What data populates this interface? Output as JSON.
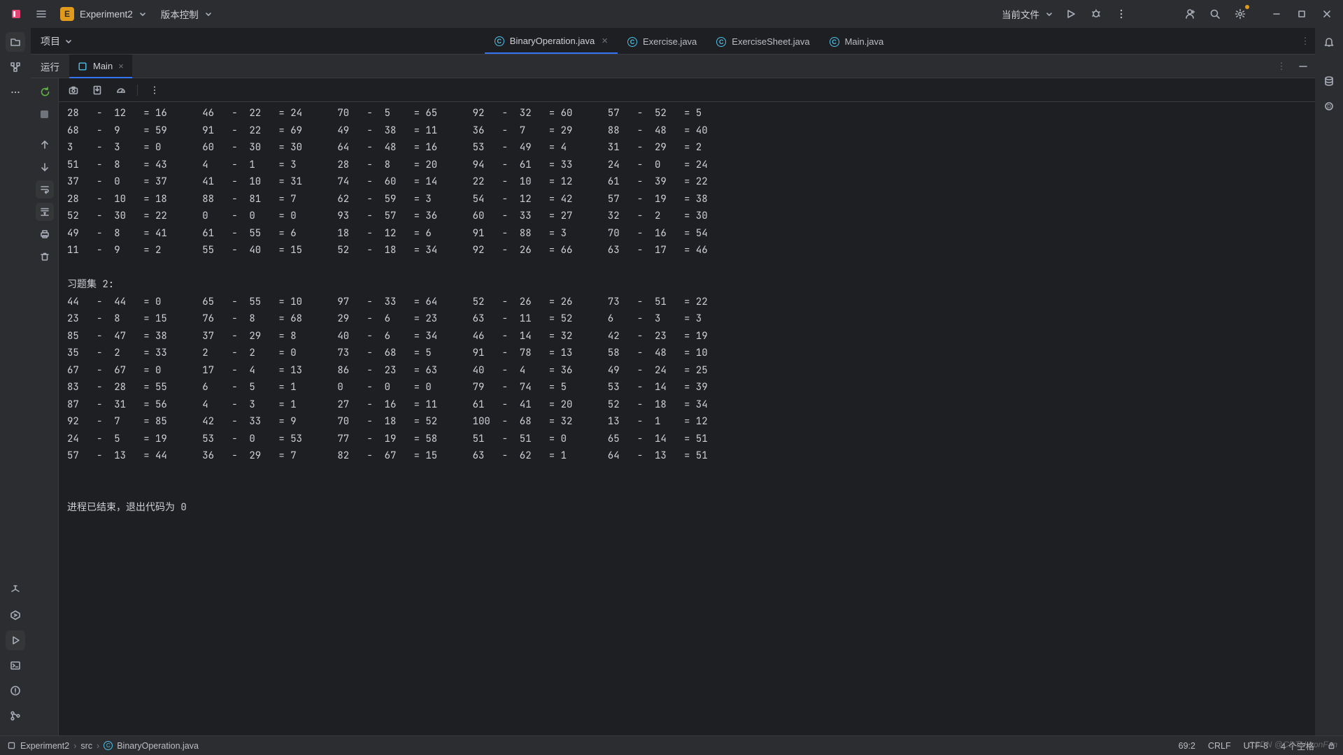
{
  "title_bar": {
    "project_letter": "E",
    "project_name": "Experiment2",
    "vcs_label": "版本控制",
    "current_file_label": "当前文件"
  },
  "editor_tabs": [
    {
      "name": "BinaryOperation.java",
      "active": true,
      "closable": true
    },
    {
      "name": "Exercise.java",
      "active": false,
      "closable": false
    },
    {
      "name": "ExerciseSheet.java",
      "active": false,
      "closable": false
    },
    {
      "name": "Main.java",
      "active": false,
      "closable": false
    }
  ],
  "project_dropdown": "项目",
  "run": {
    "tool_label": "运行",
    "tab_name": "Main",
    "exit_line": "进程已结束，退出代码为 0",
    "set2_header": "习题集 2:",
    "output_block1": [
      [
        [
          "28",
          "12",
          "16"
        ],
        [
          "46",
          "22",
          "24"
        ],
        [
          "70",
          "5",
          "65"
        ],
        [
          "92",
          "32",
          "60"
        ],
        [
          "57",
          "52",
          "5"
        ]
      ],
      [
        [
          "68",
          "9",
          "59"
        ],
        [
          "91",
          "22",
          "69"
        ],
        [
          "49",
          "38",
          "11"
        ],
        [
          "36",
          "7",
          "29"
        ],
        [
          "88",
          "48",
          "40"
        ]
      ],
      [
        [
          "3",
          "3",
          "0"
        ],
        [
          "60",
          "30",
          "30"
        ],
        [
          "64",
          "48",
          "16"
        ],
        [
          "53",
          "49",
          "4"
        ],
        [
          "31",
          "29",
          "2"
        ]
      ],
      [
        [
          "51",
          "8",
          "43"
        ],
        [
          "4",
          "1",
          "3"
        ],
        [
          "28",
          "8",
          "20"
        ],
        [
          "94",
          "61",
          "33"
        ],
        [
          "24",
          "0",
          "24"
        ]
      ],
      [
        [
          "37",
          "0",
          "37"
        ],
        [
          "41",
          "10",
          "31"
        ],
        [
          "74",
          "60",
          "14"
        ],
        [
          "22",
          "10",
          "12"
        ],
        [
          "61",
          "39",
          "22"
        ]
      ],
      [
        [
          "28",
          "10",
          "18"
        ],
        [
          "88",
          "81",
          "7"
        ],
        [
          "62",
          "59",
          "3"
        ],
        [
          "54",
          "12",
          "42"
        ],
        [
          "57",
          "19",
          "38"
        ]
      ],
      [
        [
          "52",
          "30",
          "22"
        ],
        [
          "0",
          "0",
          "0"
        ],
        [
          "93",
          "57",
          "36"
        ],
        [
          "60",
          "33",
          "27"
        ],
        [
          "32",
          "2",
          "30"
        ]
      ],
      [
        [
          "49",
          "8",
          "41"
        ],
        [
          "61",
          "55",
          "6"
        ],
        [
          "18",
          "12",
          "6"
        ],
        [
          "91",
          "88",
          "3"
        ],
        [
          "70",
          "16",
          "54"
        ]
      ],
      [
        [
          "11",
          "9",
          "2"
        ],
        [
          "55",
          "40",
          "15"
        ],
        [
          "52",
          "18",
          "34"
        ],
        [
          "92",
          "26",
          "66"
        ],
        [
          "63",
          "17",
          "46"
        ]
      ]
    ],
    "output_block2": [
      [
        [
          "44",
          "44",
          "0"
        ],
        [
          "65",
          "55",
          "10"
        ],
        [
          "97",
          "33",
          "64"
        ],
        [
          "52",
          "26",
          "26"
        ],
        [
          "73",
          "51",
          "22"
        ]
      ],
      [
        [
          "23",
          "8",
          "15"
        ],
        [
          "76",
          "8",
          "68"
        ],
        [
          "29",
          "6",
          "23"
        ],
        [
          "63",
          "11",
          "52"
        ],
        [
          "6",
          "3",
          "3"
        ]
      ],
      [
        [
          "85",
          "47",
          "38"
        ],
        [
          "37",
          "29",
          "8"
        ],
        [
          "40",
          "6",
          "34"
        ],
        [
          "46",
          "14",
          "32"
        ],
        [
          "42",
          "23",
          "19"
        ]
      ],
      [
        [
          "35",
          "2",
          "33"
        ],
        [
          "2",
          "2",
          "0"
        ],
        [
          "73",
          "68",
          "5"
        ],
        [
          "91",
          "78",
          "13"
        ],
        [
          "58",
          "48",
          "10"
        ]
      ],
      [
        [
          "67",
          "67",
          "0"
        ],
        [
          "17",
          "4",
          "13"
        ],
        [
          "86",
          "23",
          "63"
        ],
        [
          "40",
          "4",
          "36"
        ],
        [
          "49",
          "24",
          "25"
        ]
      ],
      [
        [
          "83",
          "28",
          "55"
        ],
        [
          "6",
          "5",
          "1"
        ],
        [
          "0",
          "0",
          "0"
        ],
        [
          "79",
          "74",
          "5"
        ],
        [
          "53",
          "14",
          "39"
        ]
      ],
      [
        [
          "87",
          "31",
          "56"
        ],
        [
          "4",
          "3",
          "1"
        ],
        [
          "27",
          "16",
          "11"
        ],
        [
          "61",
          "41",
          "20"
        ],
        [
          "52",
          "18",
          "34"
        ]
      ],
      [
        [
          "92",
          "7",
          "85"
        ],
        [
          "42",
          "33",
          "9"
        ],
        [
          "70",
          "18",
          "52"
        ],
        [
          "100",
          "68",
          "32"
        ],
        [
          "13",
          "1",
          "12"
        ]
      ],
      [
        [
          "24",
          "5",
          "19"
        ],
        [
          "53",
          "0",
          "53"
        ],
        [
          "77",
          "19",
          "58"
        ],
        [
          "51",
          "51",
          "0"
        ],
        [
          "65",
          "14",
          "51"
        ]
      ],
      [
        [
          "57",
          "13",
          "44"
        ],
        [
          "36",
          "29",
          "7"
        ],
        [
          "82",
          "67",
          "15"
        ],
        [
          "63",
          "62",
          "1"
        ],
        [
          "64",
          "13",
          "51"
        ]
      ]
    ]
  },
  "breadcrumbs": {
    "root": "Experiment2",
    "mid": "src",
    "file": "BinaryOperation.java"
  },
  "status": {
    "pos": "69:2",
    "eol": "CRLF",
    "enc": "UTF-8",
    "indent": "4 个空格"
  },
  "watermark": "CSDN @CDTU IronFan"
}
